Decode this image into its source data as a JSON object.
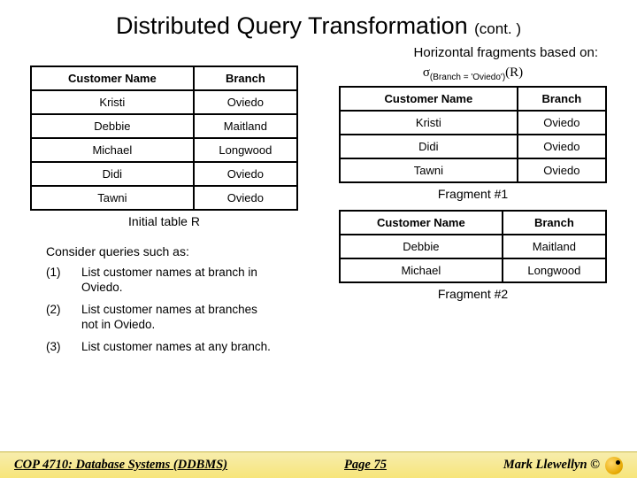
{
  "title": "Distributed Query Transformation",
  "title_cont": "(cont. )",
  "subhead": "Horizontal fragments based on:",
  "initial_table": {
    "headers": [
      "Customer Name",
      "Branch"
    ],
    "rows": [
      [
        "Kristi",
        "Oviedo"
      ],
      [
        "Debbie",
        "Maitland"
      ],
      [
        "Michael",
        "Longwood"
      ],
      [
        "Didi",
        "Oviedo"
      ],
      [
        "Tawni",
        "Oviedo"
      ]
    ],
    "caption": "Initial table R"
  },
  "formula": {
    "sigma": "σ",
    "sub": "(Branch = 'Oviedo')",
    "rel": "(R)"
  },
  "fragment1": {
    "headers": [
      "Customer Name",
      "Branch"
    ],
    "rows": [
      [
        "Kristi",
        "Oviedo"
      ],
      [
        "Didi",
        "Oviedo"
      ],
      [
        "Tawni",
        "Oviedo"
      ]
    ],
    "caption": "Fragment #1"
  },
  "fragment2": {
    "headers": [
      "Customer Name",
      "Branch"
    ],
    "rows": [
      [
        "Debbie",
        "Maitland"
      ],
      [
        "Michael",
        "Longwood"
      ]
    ],
    "caption": "Fragment #2"
  },
  "consider": "Consider queries such as:",
  "queries": [
    {
      "num": "(1)",
      "text": "List customer names at branch in Oviedo."
    },
    {
      "num": "(2)",
      "text": "List customer names at branches not in Oviedo."
    },
    {
      "num": "(3)",
      "text": "List customer names at any branch."
    }
  ],
  "footer": {
    "left": "COP 4710: Database Systems  (DDBMS)",
    "center": "Page 75",
    "right": "Mark Llewellyn ©"
  }
}
